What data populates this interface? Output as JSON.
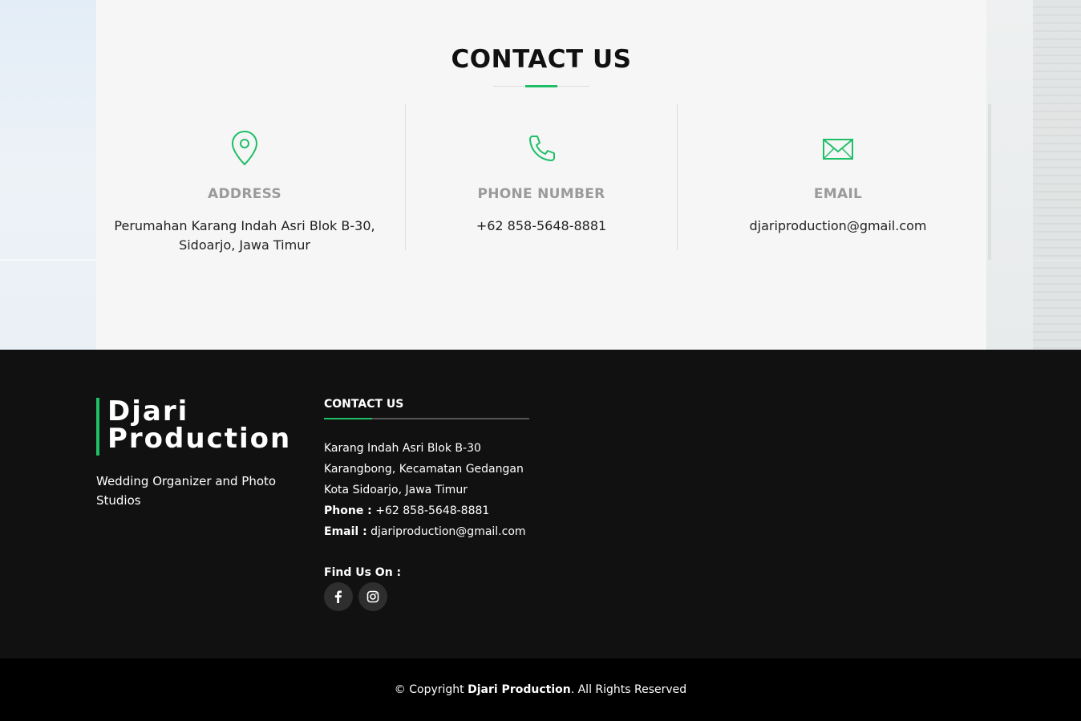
{
  "contact": {
    "title": "CONTACT US",
    "address": {
      "icon": "map-pin-icon",
      "label": "ADDRESS",
      "line1": "Perumahan Karang Indah Asri Blok B-30,",
      "line2": "Sidoarjo, Jawa Timur"
    },
    "phone": {
      "icon": "phone-icon",
      "label": "PHONE NUMBER",
      "value": "+62 858-5648-8881"
    },
    "email": {
      "icon": "envelope-icon",
      "label": "EMAIL",
      "value": "djariproduction@gmail.com"
    }
  },
  "footer": {
    "brand_line1": "Djari",
    "brand_line2": "Production",
    "tagline": "Wedding Organizer and Photo Studios",
    "contact_title": "CONTACT US",
    "address_line1": "Karang Indah Asri Blok B-30",
    "address_line2": "Karangbong, Kecamatan Gedangan",
    "address_line3": "Kota Sidoarjo, Jawa Timur",
    "phone_label": "Phone :",
    "phone_value": "+62 858-5648-8881",
    "email_label": "Email :",
    "email_value": "djariproduction@gmail.com",
    "find_us": "Find Us On :",
    "social": [
      "facebook-icon",
      "instagram-icon"
    ],
    "copyright_prefix": "© Copyright",
    "copyright_brand": "Djari Production",
    "copyright_suffix": ". All Rights Reserved"
  },
  "colors": {
    "accent": "#1fbf68",
    "footer_bg": "#111111",
    "bottom_bg": "#000000",
    "panel_bg": "#f6f6f6"
  }
}
